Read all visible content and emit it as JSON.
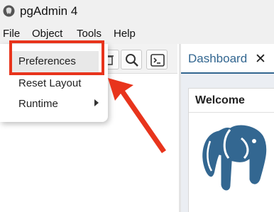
{
  "window": {
    "title": "pgAdmin 4"
  },
  "menubar": {
    "items": [
      "File",
      "Object",
      "Tools",
      "Help"
    ]
  },
  "toolbar": {
    "buttons": [
      "delete-icon",
      "search-icon",
      "terminal-icon"
    ]
  },
  "tabs": [
    {
      "label": "Dashboard",
      "close": "✕",
      "active": true
    }
  ],
  "file_menu": {
    "items": [
      {
        "label": "Preferences",
        "highlighted": true
      },
      {
        "label": "Reset Layout"
      },
      {
        "label": "Runtime",
        "submenu": true
      }
    ]
  },
  "welcome": {
    "title": "Welcome"
  },
  "colors": {
    "accent": "#326690",
    "annotation": "#e8341c"
  }
}
